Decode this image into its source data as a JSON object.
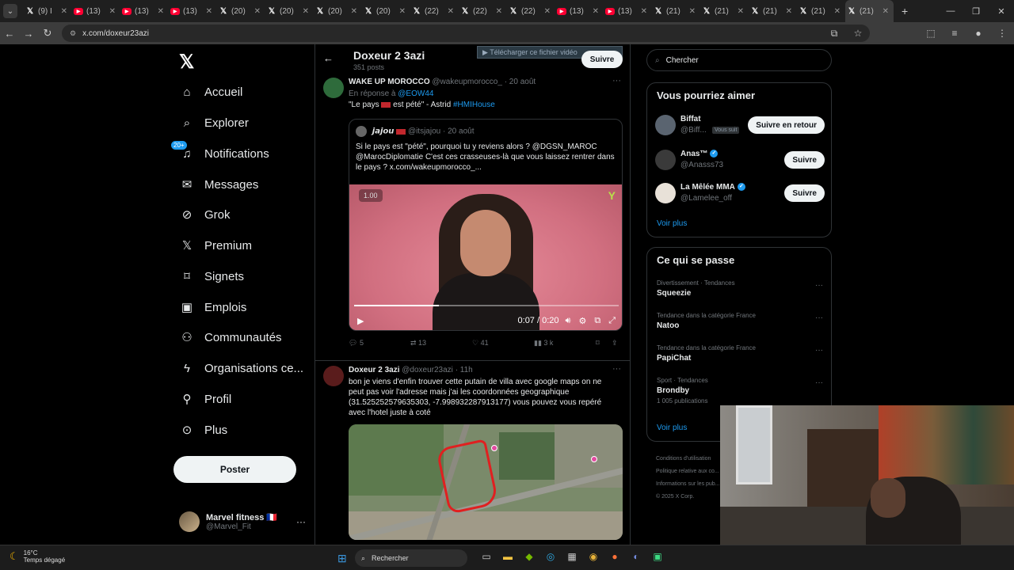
{
  "browser": {
    "tabs": [
      {
        "label": "(9) I",
        "icon": "x"
      },
      {
        "label": "(13)",
        "icon": "youtube"
      },
      {
        "label": "(13)",
        "icon": "youtube"
      },
      {
        "label": "(13)",
        "icon": "youtube"
      },
      {
        "label": "(20)",
        "icon": "x"
      },
      {
        "label": "(20)",
        "icon": "x"
      },
      {
        "label": "(20)",
        "icon": "x"
      },
      {
        "label": "(20)",
        "icon": "x"
      },
      {
        "label": "(22)",
        "icon": "x"
      },
      {
        "label": "(22)",
        "icon": "x"
      },
      {
        "label": "(22)",
        "icon": "x"
      },
      {
        "label": "(13)",
        "icon": "youtube"
      },
      {
        "label": "(13)",
        "icon": "youtube"
      },
      {
        "label": "(21)",
        "icon": "x"
      },
      {
        "label": "(21)",
        "icon": "x"
      },
      {
        "label": "(21)",
        "icon": "x"
      },
      {
        "label": "(21)",
        "icon": "x"
      },
      {
        "label": "(21)",
        "icon": "x"
      }
    ],
    "url": "x.com/doxeur23azi"
  },
  "nav": {
    "items": [
      {
        "label": "Accueil",
        "icon": "home-icon"
      },
      {
        "label": "Explorer",
        "icon": "search-icon"
      },
      {
        "label": "Notifications",
        "icon": "bell-icon",
        "badge": "20+"
      },
      {
        "label": "Messages",
        "icon": "mail-icon"
      },
      {
        "label": "Grok",
        "icon": "grok-icon"
      },
      {
        "label": "Premium",
        "icon": "x-icon"
      },
      {
        "label": "Signets",
        "icon": "bookmark-icon"
      },
      {
        "label": "Emplois",
        "icon": "briefcase-icon"
      },
      {
        "label": "Communautés",
        "icon": "people-icon"
      },
      {
        "label": "Organisations ce...",
        "icon": "lightning-icon"
      },
      {
        "label": "Profil",
        "icon": "person-icon"
      },
      {
        "label": "Plus",
        "icon": "more-circle-icon"
      }
    ],
    "post_label": "Poster",
    "account": {
      "name": "Marvel fitness 🇫🇷",
      "handle": "@Marvel_Fit"
    }
  },
  "header": {
    "title": "Doxeur 2 3azi",
    "subtitle": "351 posts",
    "follow_label": "Suivre",
    "download_banner": "▶ Télécharger ce fichier vidéo"
  },
  "tweet1": {
    "author": "WAKE UP MOROCCO",
    "handle": "@wakeupmorocco_",
    "date": "· 20 août",
    "reply_prefix": "En réponse à",
    "reply_to": "@EOW44",
    "text_a": "\"Le pays",
    "text_b": "est pété\" - Astrid",
    "hashtag": "#HMIHouse",
    "quote": {
      "author": "𝙟𝙖𝙟𝙤𝙪",
      "handle": "@itsjajou",
      "date": "· 20 août",
      "text": "Si le pays est \"pété\", pourquoi tu y reviens alors ? @DGSN_MAROC @MarocDiplomatie C'est ces crasseuses-là que vous laissez rentrer dans le pays ? x.com/wakeupmorocco_..."
    },
    "video": {
      "speed": "1.00",
      "time": "0:07 / 0:20",
      "progress": 0.32
    },
    "stats": {
      "replies": "5",
      "reposts": "13",
      "likes": "41",
      "views": "3 k"
    }
  },
  "tweet2": {
    "author": "Doxeur 2 3azi",
    "handle": "@doxeur23azi",
    "date": "· 11h",
    "text": "bon je viens d'enfin trouver cette putain de villa avec google maps on ne peut pas voir l'adresse mais j'ai les coordonnées geographique (31.525252579635303, -7.998932287913177) vous pouvez vous repéré avec l'hotel juste à coté"
  },
  "right": {
    "search_placeholder": "Chercher",
    "suggest_title": "Vous pourriez aimer",
    "suggestions": [
      {
        "name": "Biffat",
        "handle": "@Biff...",
        "tag": "Vous suit",
        "button": "Suivre en retour",
        "verified": false
      },
      {
        "name": "Anas™",
        "handle": "@Anasss73",
        "tag": "",
        "button": "Suivre",
        "verified": true
      },
      {
        "name": "La Mêlée MMA",
        "handle": "@Lamelee_off",
        "tag": "",
        "button": "Suivre",
        "verified": true
      }
    ],
    "see_more": "Voir plus",
    "trends_title": "Ce qui se passe",
    "trends": [
      {
        "category": "Divertissement · Tendances",
        "name": "Squeezie",
        "count": ""
      },
      {
        "category": "Tendance dans la catégorie France",
        "name": "Natoo",
        "count": ""
      },
      {
        "category": "Tendance dans la catégorie France",
        "name": "PapiChat",
        "count": ""
      },
      {
        "category": "Sport · Tendances",
        "name": "Brondby",
        "count": "1 005 publications"
      }
    ],
    "see_more2": "Voir plus",
    "footer": [
      "Conditions d'utilisation",
      "Politique relative aux co...",
      "Informations sur les pub...",
      "© 2025 X Corp."
    ]
  },
  "taskbar": {
    "temp": "16°C",
    "weather": "Temps dégagé",
    "search": "Rechercher"
  }
}
